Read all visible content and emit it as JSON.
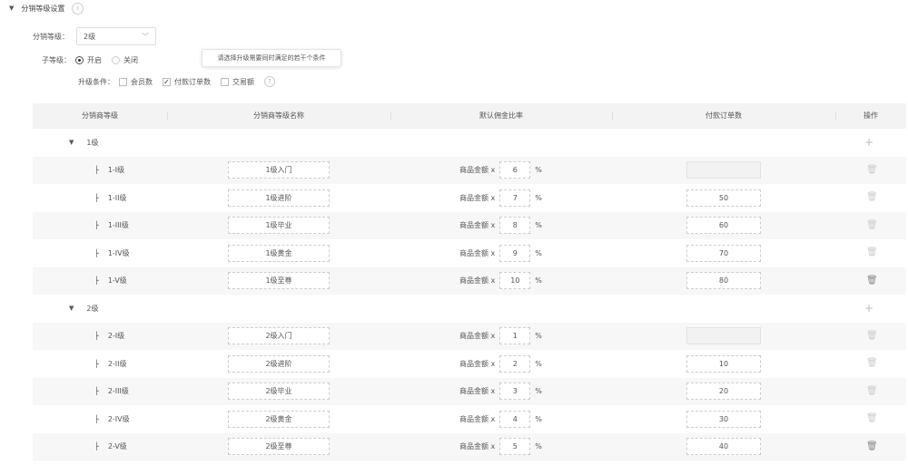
{
  "section": {
    "title": "分销等级设置",
    "info": "i"
  },
  "level_field": {
    "label": "分销等级：",
    "value": "2级"
  },
  "sub_level": {
    "label": "子等级：",
    "on_label": "开启",
    "off_label": "关闭"
  },
  "tooltip": "请选择升级需要同时满足的若干个条件",
  "upgrade": {
    "label": "升级条件：",
    "options": [
      {
        "label": "会员数",
        "checked": false
      },
      {
        "label": "付款订单数",
        "checked": true
      },
      {
        "label": "交易额",
        "checked": false
      }
    ]
  },
  "table": {
    "headers": [
      "分销商等级",
      "分销商等级名称",
      "默认佣金比率",
      "付款订单数",
      "操作"
    ],
    "commission_prefix": "商品金额 x",
    "percent": "%",
    "groups": [
      {
        "name": "1级",
        "rows": [
          {
            "level": "1-I级",
            "name": "1级入门",
            "rate": "6",
            "orders": ""
          },
          {
            "level": "1-II级",
            "name": "1级进阶",
            "rate": "7",
            "orders": "50"
          },
          {
            "level": "1-III级",
            "name": "1级毕业",
            "rate": "8",
            "orders": "60"
          },
          {
            "level": "1-IV级",
            "name": "1级黄金",
            "rate": "9",
            "orders": "70"
          },
          {
            "level": "1-V级",
            "name": "1级至尊",
            "rate": "10",
            "orders": "80"
          }
        ]
      },
      {
        "name": "2级",
        "rows": [
          {
            "level": "2-I级",
            "name": "2级入门",
            "rate": "1",
            "orders": ""
          },
          {
            "level": "2-II级",
            "name": "2级进阶",
            "rate": "2",
            "orders": "10"
          },
          {
            "level": "2-III级",
            "name": "2级毕业",
            "rate": "3",
            "orders": "20"
          },
          {
            "level": "2-IV级",
            "name": "2级黄金",
            "rate": "4",
            "orders": "30"
          },
          {
            "level": "2-V级",
            "name": "2级至尊",
            "rate": "5",
            "orders": "40"
          }
        ]
      }
    ]
  }
}
